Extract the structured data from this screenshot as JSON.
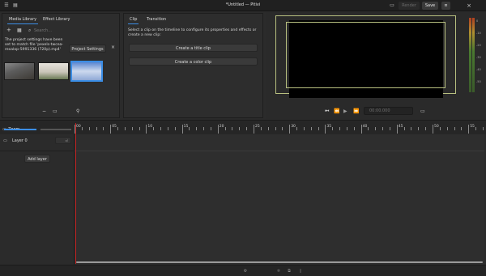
{
  "app": {
    "title": "*Untitled — Pitivi",
    "render_label": "Render",
    "save_label": "Save",
    "close_glyph": "×"
  },
  "media_library": {
    "tabs": [
      "Media Library",
      "Effect Library"
    ],
    "search_placeholder": "Search...",
    "notice": "The project settings have been set to match file 'pexels-twcea-rexalop-5991336 (720p).mp4'",
    "project_settings_label": "Project Settings",
    "dismiss_glyph": "×",
    "thumbnails": [
      {
        "name": "clip-thumbnail-1",
        "colors": [
          "#6f6f6f",
          "#3e3a33"
        ]
      },
      {
        "name": "clip-thumbnail-2",
        "colors": [
          "#d9d6cf",
          "#76805f"
        ]
      },
      {
        "name": "clip-thumbnail-3",
        "colors": [
          "#6e95d6",
          "#cdd9ee"
        ],
        "selected": true
      }
    ]
  },
  "clip_panel": {
    "tabs": [
      "Clip",
      "Transition"
    ],
    "description": "Select a clip on the timeline to configure its properties and effects or create a new clip:",
    "create_title_label": "Create a title clip",
    "create_color_label": "Create a color clip"
  },
  "viewer": {
    "timecode": "00:00.000"
  },
  "timeline": {
    "zoom_label": "Zoom",
    "layer_name": "Layer 0",
    "add_layer_label": "Add layer",
    "ruler_labels": [
      "00",
      "05",
      "10",
      "15",
      "20",
      "25",
      "30",
      "35",
      "40",
      "45",
      "50",
      "55"
    ]
  },
  "meter_labels": [
    "0",
    "-10",
    "-20",
    "-30",
    "-40",
    "-50"
  ],
  "colors": {
    "accent": "#3b8ee6",
    "playhead": "#c02020",
    "safe_area": "#b8c080"
  }
}
